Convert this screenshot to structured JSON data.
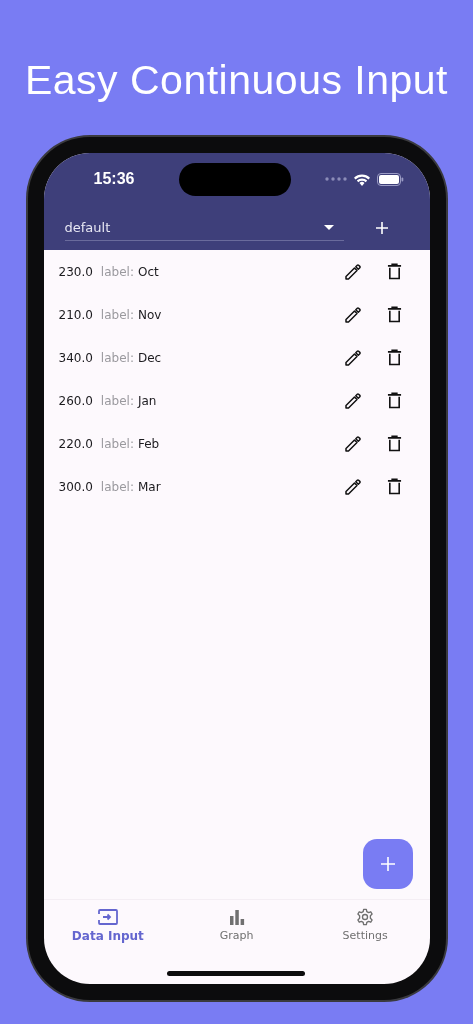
{
  "title": "Easy Continuous Input",
  "status_bar": {
    "time": "15:36"
  },
  "dataset_selector": {
    "value": "default"
  },
  "entries": [
    {
      "value": "230.0",
      "caption": "label:",
      "label": "Oct"
    },
    {
      "value": "210.0",
      "caption": "label:",
      "label": "Nov"
    },
    {
      "value": "340.0",
      "caption": "label:",
      "label": "Dec"
    },
    {
      "value": "260.0",
      "caption": "label:",
      "label": "Jan"
    },
    {
      "value": "220.0",
      "caption": "label:",
      "label": "Feb"
    },
    {
      "value": "300.0",
      "caption": "label:",
      "label": "Mar"
    }
  ],
  "nav": [
    {
      "kind": "input",
      "label": "Data Input",
      "selected": true
    },
    {
      "kind": "graph",
      "label": "Graph",
      "selected": false
    },
    {
      "kind": "settings",
      "label": "Settings",
      "selected": false
    }
  ]
}
